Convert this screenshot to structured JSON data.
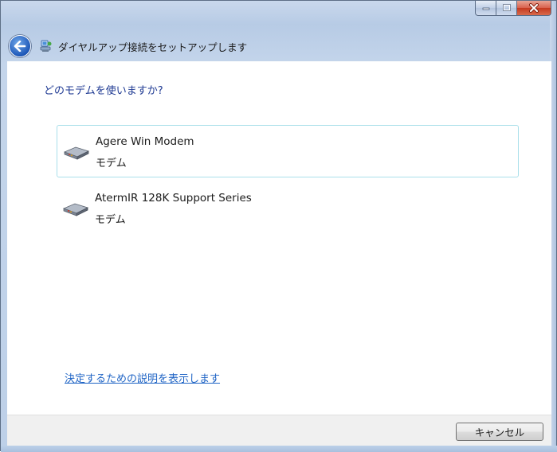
{
  "window": {
    "title": "ダイヤルアップ接続をセットアップします",
    "accent": "#1e58b8"
  },
  "caption_buttons": {
    "minimize_icon": "minimize-icon",
    "maximize_icon": "maximize-icon",
    "close_icon": "close-icon"
  },
  "main": {
    "question": "どのモデムを使いますか?",
    "modems": [
      {
        "name": "Agere Win Modem",
        "type": "モデム",
        "selected": true,
        "icon": "modem-icon"
      },
      {
        "name": "AtermIR 128K Support Series",
        "type": "モデム",
        "selected": false,
        "icon": "modem-icon"
      }
    ],
    "help_link": "決定するための説明を表示します"
  },
  "footer": {
    "cancel_label": "キャンセル"
  }
}
